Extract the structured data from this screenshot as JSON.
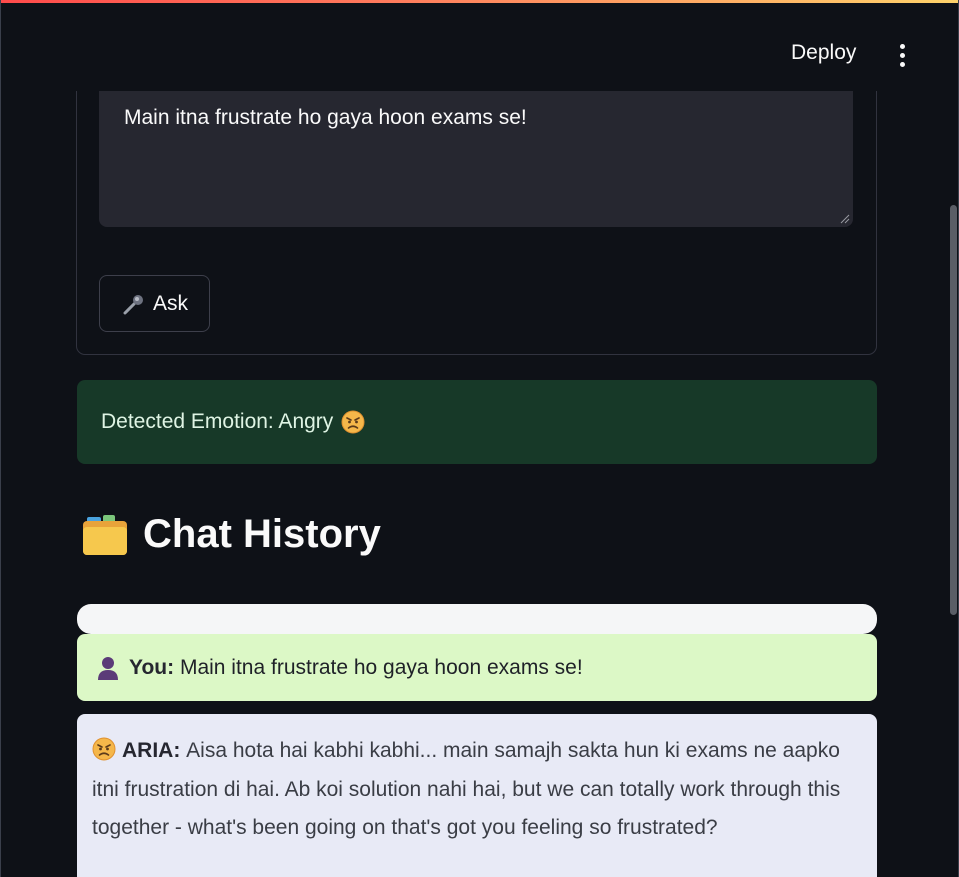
{
  "header": {
    "deploy_label": "Deploy",
    "menu_icon": "kebab-menu-icon"
  },
  "form": {
    "question_value": "Main itna frustrate ho gaya hoon exams se!",
    "ask_label": "Ask",
    "ask_icon": "microphone-icon"
  },
  "emotion": {
    "text": "Detected Emotion: Angry",
    "icon": "angry-face-icon"
  },
  "chat_history": {
    "title": "Chat History",
    "icon": "folder-icon",
    "messages": [
      {
        "speaker": "You:",
        "text": "Main itna frustrate ho gaya hoon exams se!",
        "icon": "person-icon"
      },
      {
        "speaker": "ARIA:",
        "text": "Aisa hota hai kabhi kabhi... main samajh sakta hun ki exams ne aapko itni frustration di hai. Ab koi solution nahi hai, but we can totally work through this together - what's been going on that's got you feeling so frustrated?",
        "icon": "angry-face-icon"
      }
    ]
  },
  "colors": {
    "background": "#0e1117",
    "emotion_bg": "#173928",
    "user_bubble": "#dcf8c6",
    "aria_bubble": "#e8eaf6",
    "accent_gradient_start": "#ff4b4b",
    "accent_gradient_end": "#ffd36b"
  }
}
